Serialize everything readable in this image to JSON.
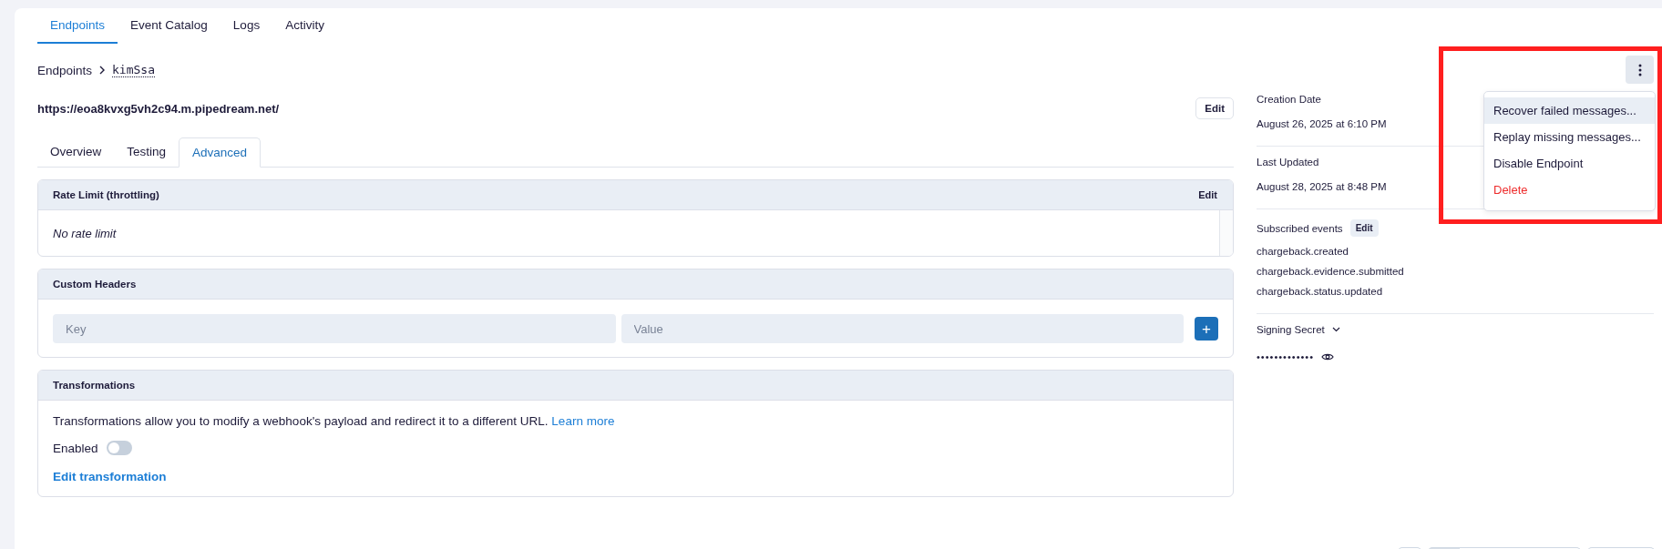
{
  "nav_tabs": [
    {
      "label": "Endpoints",
      "selected": true
    },
    {
      "label": "Event Catalog",
      "selected": false
    },
    {
      "label": "Logs",
      "selected": false
    },
    {
      "label": "Activity",
      "selected": false
    }
  ],
  "breadcrumb": {
    "parent": "Endpoints",
    "current": "kimSsa"
  },
  "endpoint": {
    "url": "https://eoa8kvxg5vh2c94.m.pipedream.net/",
    "edit_button": "Edit"
  },
  "sub_tabs": [
    {
      "label": "Overview",
      "selected": false
    },
    {
      "label": "Testing",
      "selected": false
    },
    {
      "label": "Advanced",
      "selected": true
    }
  ],
  "rate_limit": {
    "title": "Rate Limit (throttling)",
    "edit_button": "Edit",
    "value": "No rate limit"
  },
  "custom_headers": {
    "title": "Custom Headers",
    "key_placeholder": "Key",
    "value_placeholder": "Value",
    "add_button": "+"
  },
  "transformations": {
    "title": "Transformations",
    "description": "Transformations allow you to modify a webhook's payload and redirect it to a different URL.",
    "learn_more": "Learn more",
    "enabled_label": "Enabled",
    "enabled": false,
    "edit_link": "Edit transformation"
  },
  "details": {
    "creation_label": "Creation Date",
    "creation_value": "August 26, 2025 at 6:10 PM",
    "updated_label": "Last Updated",
    "updated_value": "August 28, 2025 at 8:48 PM",
    "events_label": "Subscribed events",
    "events_edit": "Edit",
    "events": [
      "chargeback.created",
      "chargeback.evidence.submitted",
      "chargeback.status.updated"
    ],
    "secret_label": "Signing Secret",
    "secret_value": "•••••••••••••"
  },
  "menu": {
    "items": [
      {
        "label": "Recover failed messages...",
        "kind": "normal",
        "selected": true
      },
      {
        "label": "Replay missing messages...",
        "kind": "normal",
        "selected": false
      },
      {
        "label": "Disable Endpoint",
        "kind": "normal",
        "selected": false
      },
      {
        "label": "Delete",
        "kind": "danger",
        "selected": false
      }
    ]
  }
}
